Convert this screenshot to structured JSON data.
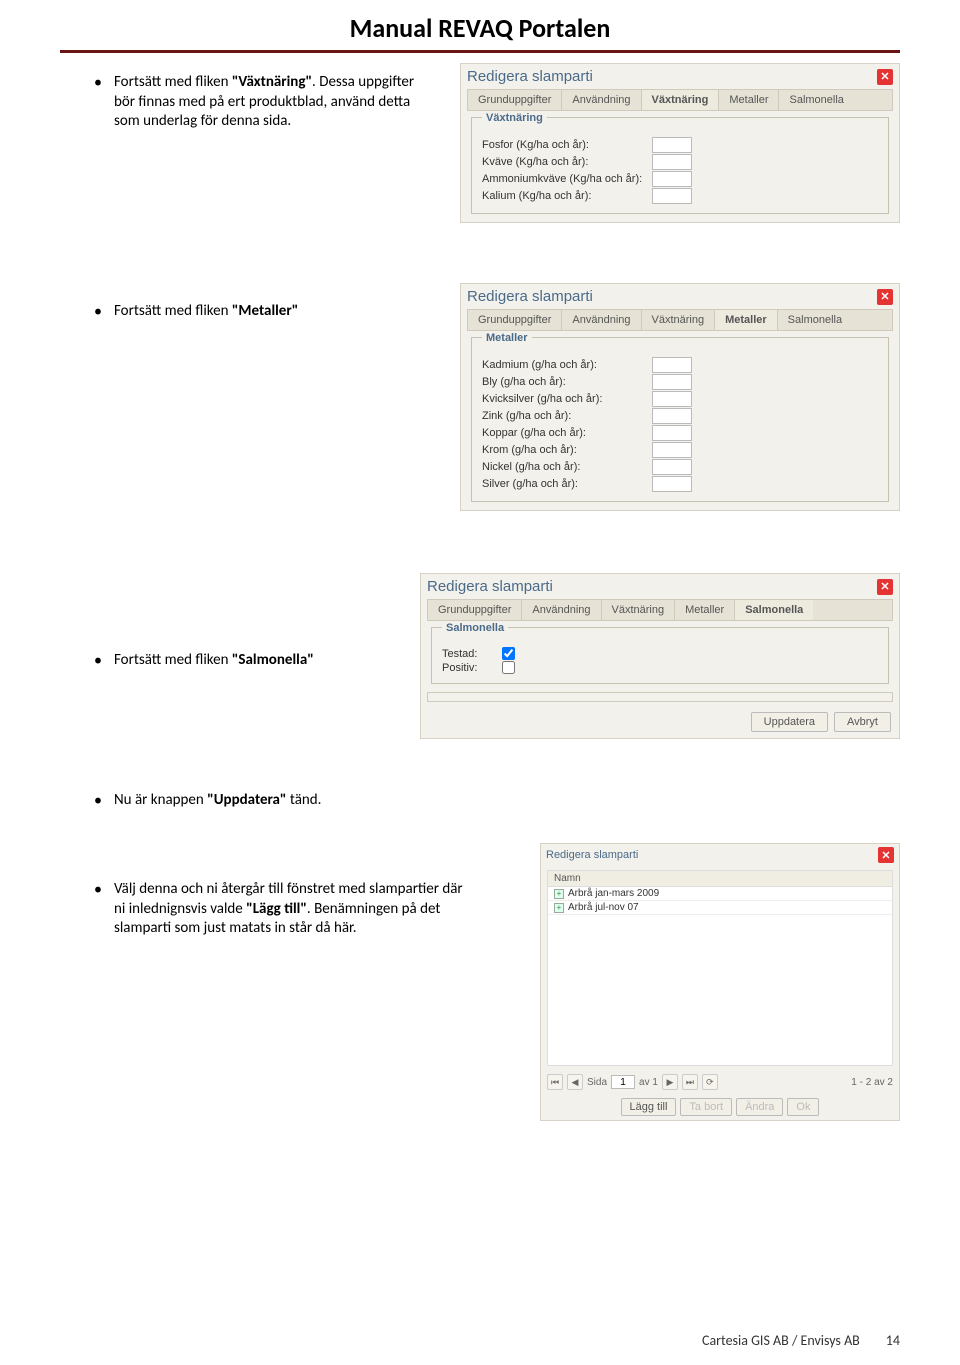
{
  "header": {
    "title": "Manual REVAQ Portalen"
  },
  "doc": {
    "bullet1a": "Fortsätt med fliken ",
    "bullet1b": "\"Växtnäring\"",
    "bullet1c": ". Dessa uppgifter bör finnas med på ert produktblad, använd detta som underlag för denna sida.",
    "bullet2a": "Fortsätt med fliken ",
    "bullet2b": "\"Metaller\"",
    "bullet3a": "Fortsätt med fliken ",
    "bullet3b": "\"Salmonella\"",
    "bullet4a": "Nu är knappen ",
    "bullet4b": "\"Uppdatera\"",
    "bullet4c": " tänd.",
    "bullet5a": "Välj denna och ni återgår till fönstret  med slampartier där ni inlednignsvis valde ",
    "bullet5b": "\"Lägg till\"",
    "bullet5c": ".  Benämningen på det slamparti som just matats in står då här."
  },
  "shot1": {
    "title": "Redigera slamparti",
    "tabs": [
      "Grunduppgifter",
      "Användning",
      "Växtnäring",
      "Metaller",
      "Salmonella"
    ],
    "legend": "Växtnäring",
    "fields": [
      "Fosfor (Kg/ha och år):",
      "Kväve (Kg/ha och år):",
      "Ammoniumkväve (Kg/ha och år):",
      "Kalium (Kg/ha och år):"
    ]
  },
  "shot2": {
    "title": "Redigera slamparti",
    "tabs": [
      "Grunduppgifter",
      "Användning",
      "Växtnäring",
      "Metaller",
      "Salmonella"
    ],
    "legend": "Metaller",
    "fields": [
      "Kadmium (g/ha och år):",
      "Bly (g/ha och år):",
      "Kvicksilver (g/ha och år):",
      "Zink (g/ha och år):",
      "Koppar (g/ha och år):",
      "Krom (g/ha och år):",
      "Nickel (g/ha och år):",
      "Silver (g/ha och år):"
    ]
  },
  "shot3": {
    "title": "Redigera slamparti",
    "tabs": [
      "Grunduppgifter",
      "Användning",
      "Växtnäring",
      "Metaller",
      "Salmonella"
    ],
    "legend": "Salmonella",
    "testad": "Testad:",
    "positiv": "Positiv:",
    "btn_update": "Uppdatera",
    "btn_cancel": "Avbryt"
  },
  "shot4": {
    "title": "Redigera slamparti",
    "col_name": "Namn",
    "rows": [
      "Arbrå jan-mars 2009",
      "Arbrå jul-nov 07"
    ],
    "pager_sida": "Sida",
    "pager_page": "1",
    "pager_av": "av 1",
    "pager_right": "1 - 2 av 2",
    "btn_add": "Lägg till",
    "btn_del": "Ta bort",
    "btn_edit": "Ändra",
    "btn_ok": "Ok"
  },
  "footer": {
    "left": "Cartesia GIS AB  / Envisys AB",
    "page": "14"
  }
}
